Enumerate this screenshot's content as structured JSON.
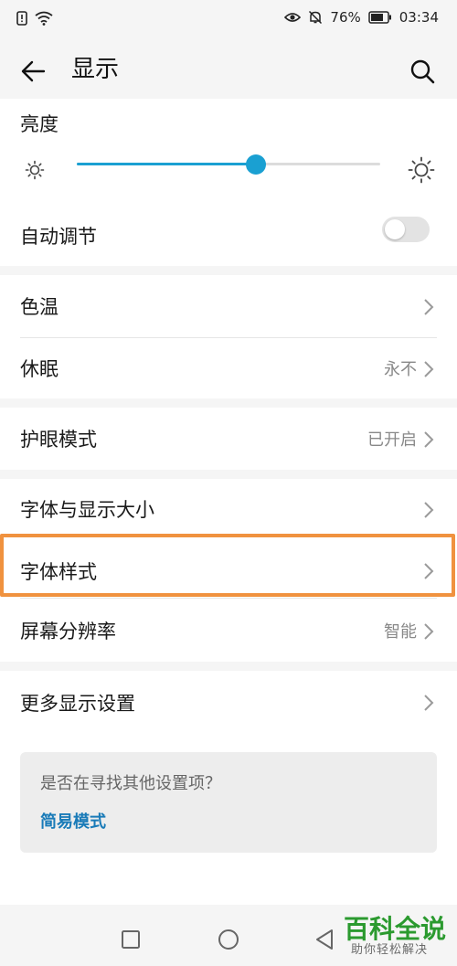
{
  "status_bar": {
    "battery_percent": "76%",
    "time": "03:34"
  },
  "header": {
    "title": "显示"
  },
  "brightness": {
    "label": "亮度",
    "level": 0.59
  },
  "auto_adjust": {
    "label": "自动调节",
    "enabled": false
  },
  "rows": {
    "color_temp": {
      "label": "色温",
      "value": ""
    },
    "sleep": {
      "label": "休眠",
      "value": "永不"
    },
    "eye_comfort": {
      "label": "护眼模式",
      "value": "已开启"
    },
    "font_display_size": {
      "label": "字体与显示大小",
      "value": ""
    },
    "font_style": {
      "label": "字体样式",
      "value": ""
    },
    "resolution": {
      "label": "屏幕分辨率",
      "value": "智能"
    },
    "more_display": {
      "label": "更多显示设置",
      "value": ""
    }
  },
  "suggestion": {
    "question": "是否在寻找其他设置项？",
    "link": "简易模式"
  },
  "watermark": {
    "main": "百科全说",
    "sub": "助你轻松解决"
  },
  "colors": {
    "accent": "#1aa0d2",
    "highlight": "#f0923f",
    "link": "#1a7bb8",
    "watermark": "#2b9a2f"
  },
  "icons": {
    "back": "arrow-left-icon",
    "search": "search-icon",
    "brightness_low": "sun-small-icon",
    "brightness_high": "sun-large-icon",
    "chevron": "chevron-right-icon",
    "nav_recent": "square-icon",
    "nav_home": "circle-icon",
    "nav_back": "triangle-left-icon"
  }
}
